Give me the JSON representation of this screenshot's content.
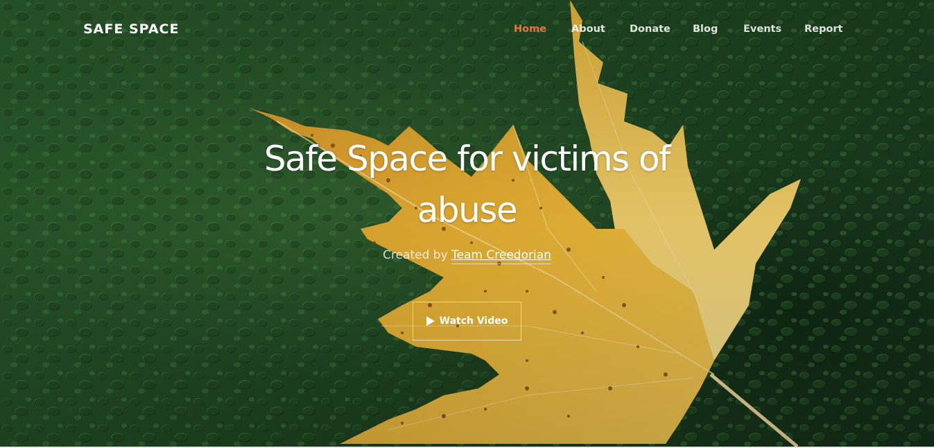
{
  "header": {
    "brand": "SAFE SPACE",
    "nav": [
      {
        "label": "Home",
        "active": true
      },
      {
        "label": "About",
        "active": false
      },
      {
        "label": "Donate",
        "active": false
      },
      {
        "label": "Blog",
        "active": false
      },
      {
        "label": "Events",
        "active": false
      },
      {
        "label": "Report",
        "active": false
      }
    ]
  },
  "hero": {
    "title_line1": "Safe Space for victims of",
    "title_line2": "abuse",
    "credit_prefix": "Created by",
    "credit_team": "Team Creedorian",
    "watch_label": "Watch Video",
    "watch_icon": "play-icon",
    "background": "yellow-maple-leaf-on-green-water-drops"
  },
  "colors": {
    "accent": "#e8743b",
    "text": "#ffffff",
    "background_green": "#234d25",
    "leaf_yellow": "#e9b632"
  }
}
